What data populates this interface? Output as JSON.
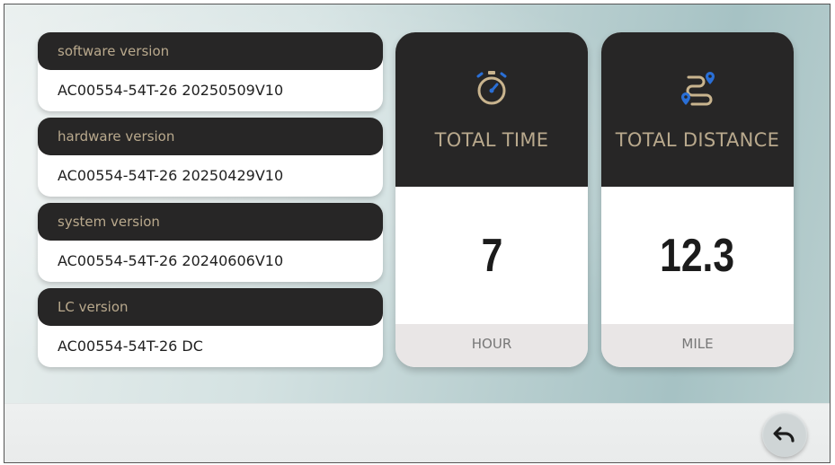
{
  "versions": [
    {
      "label": "software version",
      "value": "AC00554-54T-26 20250509V10"
    },
    {
      "label": "hardware version",
      "value": "AC00554-54T-26 20250429V10"
    },
    {
      "label": "system version",
      "value": "AC00554-54T-26 20240606V10"
    },
    {
      "label": "LC version",
      "value": "AC00554-54T-26 DC"
    }
  ],
  "stats": {
    "time": {
      "icon": "stopwatch-icon",
      "label": "TOTAL TIME",
      "value": "7",
      "unit": "HOUR"
    },
    "distance": {
      "icon": "route-icon",
      "label": "TOTAL DISTANCE",
      "value": "12.3",
      "unit": "MILE"
    }
  },
  "footer": {
    "back_icon": "back-arrow-icon"
  },
  "colors": {
    "header_bg": "#272626",
    "header_text": "#b9a98d",
    "icon_accent": "#c9b48e",
    "pin_blue": "#2a6fd6",
    "unit_bg": "#e9e6e6"
  }
}
